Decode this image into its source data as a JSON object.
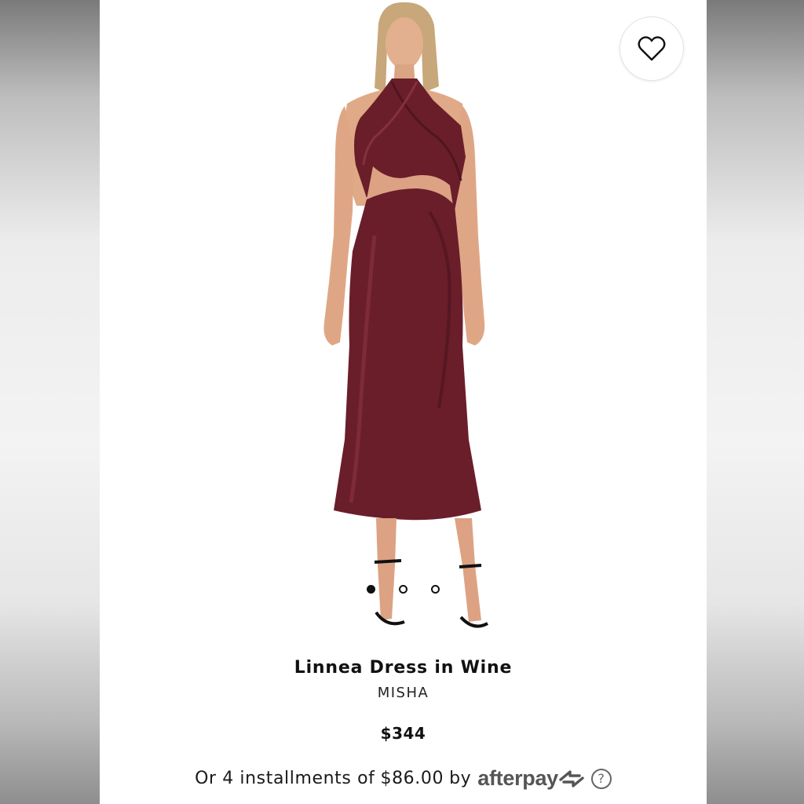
{
  "product": {
    "name": "Linnea Dress in Wine",
    "brand": "MISHA",
    "price": "$344",
    "image_alt": "Model wearing wine satin halter midi dress with front cutout",
    "dress_color": "#6a1e2a"
  },
  "gallery": {
    "total_images": 3,
    "active_index": 0
  },
  "favorite": {
    "icon": "heart-outline-icon"
  },
  "installments": {
    "prefix": "Or 4 installments of",
    "amount": "$86.00",
    "by": "by",
    "provider": "afterpay",
    "provider_icon": "afterpay-arrows-icon",
    "help_symbol": "?"
  }
}
